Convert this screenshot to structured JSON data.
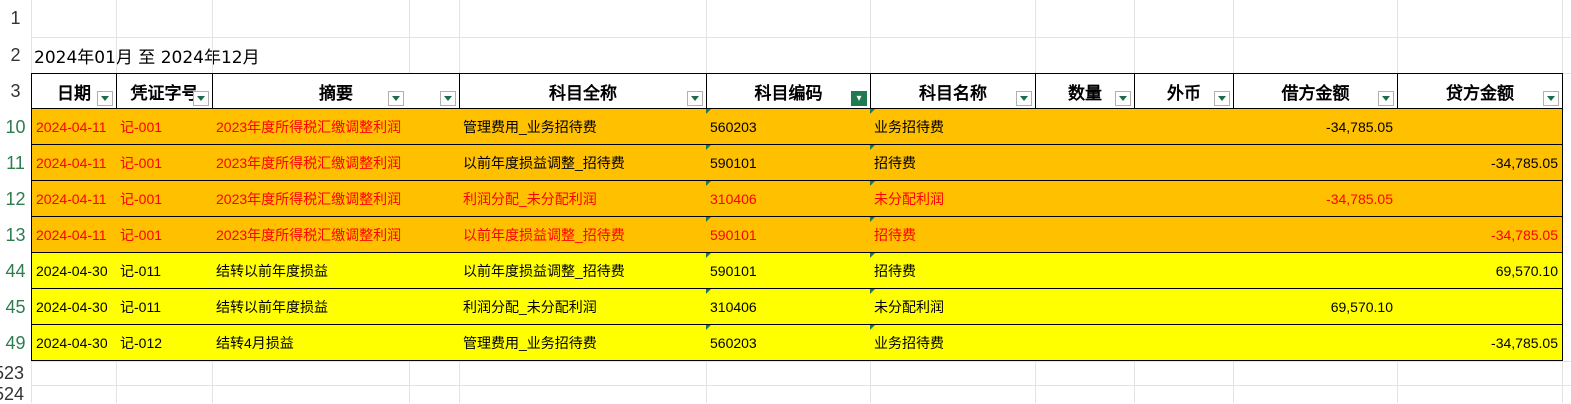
{
  "spreadsheet": {
    "period_label": "2024年01月 至 2024年12月",
    "row_numbers": [
      "1",
      "2",
      "3",
      "10",
      "11",
      "12",
      "13",
      "44",
      "45",
      "49",
      "523",
      "524"
    ],
    "headers": [
      {
        "key": "date",
        "label": "日期",
        "filter_active": false
      },
      {
        "key": "voucher",
        "label": "凭证字号",
        "filter_active": false
      },
      {
        "key": "summary",
        "label": "摘要",
        "filter_active": false
      },
      {
        "key": "account_full",
        "label": "科目全称",
        "filter_active": false
      },
      {
        "key": "account_code",
        "label": "科目编码",
        "filter_active": true
      },
      {
        "key": "account_name",
        "label": "科目名称",
        "filter_active": false
      },
      {
        "key": "quantity",
        "label": "数量",
        "filter_active": false
      },
      {
        "key": "currency",
        "label": "外币",
        "filter_active": false
      },
      {
        "key": "debit",
        "label": "借方金额",
        "filter_active": false
      },
      {
        "key": "credit",
        "label": "贷方金额",
        "filter_active": false
      }
    ],
    "colors": {
      "orange": "#ffc000",
      "yellow": "#ffff00",
      "red_text": "#ff0000",
      "filter_green": "#1f7a4f"
    },
    "rows": [
      {
        "rownum": "10",
        "fill": "orange",
        "date": "2024-04-11",
        "voucher": "记-001",
        "summary": "2023年度所得税汇缴调整利润",
        "account_full": "管理费用_业务招待费",
        "account_code": "560203",
        "account_name": "业务招待费",
        "quantity": "",
        "currency": "",
        "debit": "-34,785.05",
        "credit": "",
        "red": [
          "date",
          "voucher",
          "summary"
        ]
      },
      {
        "rownum": "11",
        "fill": "orange",
        "date": "2024-04-11",
        "voucher": "记-001",
        "summary": "2023年度所得税汇缴调整利润",
        "account_full": "以前年度损益调整_招待费",
        "account_code": "590101",
        "account_name": "招待费",
        "quantity": "",
        "currency": "",
        "debit": "",
        "credit": "-34,785.05",
        "red": [
          "date",
          "voucher",
          "summary"
        ]
      },
      {
        "rownum": "12",
        "fill": "orange",
        "date": "2024-04-11",
        "voucher": "记-001",
        "summary": "2023年度所得税汇缴调整利润",
        "account_full": "利润分配_未分配利润",
        "account_code": "310406",
        "account_name": "未分配利润",
        "quantity": "",
        "currency": "",
        "debit": "-34,785.05",
        "credit": "",
        "red": [
          "date",
          "voucher",
          "summary",
          "account_full",
          "account_code",
          "account_name",
          "debit"
        ]
      },
      {
        "rownum": "13",
        "fill": "orange",
        "date": "2024-04-11",
        "voucher": "记-001",
        "summary": "2023年度所得税汇缴调整利润",
        "account_full": "以前年度损益调整_招待费",
        "account_code": "590101",
        "account_name": "招待费",
        "quantity": "",
        "currency": "",
        "debit": "",
        "credit": "-34,785.05",
        "red": [
          "date",
          "voucher",
          "summary",
          "account_full",
          "account_code",
          "account_name",
          "credit"
        ]
      },
      {
        "rownum": "44",
        "fill": "yellow",
        "date": "2024-04-30",
        "voucher": "记-011",
        "summary": "结转以前年度损益",
        "account_full": "以前年度损益调整_招待费",
        "account_code": "590101",
        "account_name": "招待费",
        "quantity": "",
        "currency": "",
        "debit": "",
        "credit": "69,570.10",
        "red": []
      },
      {
        "rownum": "45",
        "fill": "yellow",
        "date": "2024-04-30",
        "voucher": "记-011",
        "summary": "结转以前年度损益",
        "account_full": "利润分配_未分配利润",
        "account_code": "310406",
        "account_name": "未分配利润",
        "quantity": "",
        "currency": "",
        "debit": "69,570.10",
        "credit": "",
        "red": []
      },
      {
        "rownum": "49",
        "fill": "yellow",
        "date": "2024-04-30",
        "voucher": "记-012",
        "summary": "结转4月损益",
        "account_full": "管理费用_业务招待费",
        "account_code": "560203",
        "account_name": "业务招待费",
        "quantity": "",
        "currency": "",
        "debit": "",
        "credit": "-34,785.05",
        "red": []
      }
    ]
  }
}
